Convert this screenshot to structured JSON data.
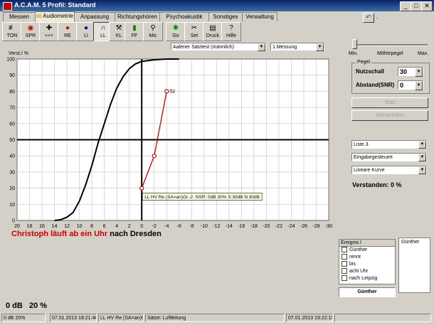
{
  "window": {
    "title": "A.C.A.M. 5  Profil: Standard"
  },
  "tabs": [
    "Messen",
    "Audiometrie",
    "Anpassung",
    "Richtungshören",
    "Psychoakustik",
    "Sonstiges",
    "Verwaltung"
  ],
  "toolbar": [
    "TON",
    "SPR",
    "+++",
    "RE",
    "LI",
    "LL",
    "KL",
    "FF",
    "Mic",
    "Go",
    "Set",
    "Druck",
    "Hilfe"
  ],
  "test_select": "Aalener Satztest (männlich)",
  "measure_select": "1.Messung",
  "level_slider": {
    "min": "Min.",
    "mid": "Mithörpegel",
    "max": "Max."
  },
  "pegel": {
    "title": "Pegel",
    "nutzschall_label": "Nutzschall",
    "nutzschall_value": "30",
    "abstand_label": "Abstand(SNR)",
    "abstand_value": "0"
  },
  "buttons": {
    "start": "Start",
    "repeat": "Wiederholen"
  },
  "dropdowns": [
    "Liste 3",
    "Eingabegesteuert",
    "Lineare Kurve"
  ],
  "verstanden": "Verstanden: 0 %",
  "sentence": {
    "part1": "Christoph läuft ab ein Uhr",
    "part2": "nach Dresden"
  },
  "result": "0 dB   20 %",
  "ereignis": {
    "header": "Ereignis l",
    "items": [
      "Günther",
      "rennt",
      "bis",
      "acht Uhr",
      "nach Leipzig"
    ],
    "right_title": "Günther",
    "selected": "Günther"
  },
  "statusbar": [
    "0 dB   20%",
    "07.01.2013 19:21:46",
    "LL HV Re (SA=an)Gr.:",
    "Sätze: Luftleitung",
    "07.01.2013 19:22:15"
  ],
  "chart_data": {
    "type": "line",
    "ylabel": "Verst./ %",
    "xlabel": "",
    "x_ticks": [
      20,
      18,
      16,
      14,
      12,
      10,
      8,
      6,
      4,
      2,
      0,
      -2,
      -4,
      -6,
      -8,
      -10,
      -12,
      -14,
      -16,
      -18,
      -20,
      -22,
      -24,
      -26,
      -28,
      -30
    ],
    "y_ticks": [
      0,
      10,
      20,
      30,
      40,
      50,
      60,
      70,
      80,
      90,
      100
    ],
    "xlim": [
      20,
      -30
    ],
    "ylim": [
      0,
      100
    ],
    "grid": true,
    "series": [
      {
        "color": "#000000",
        "x": [
          14,
          13,
          12,
          11,
          10,
          9,
          8,
          7,
          6,
          5,
          4,
          3,
          2,
          1,
          0,
          -2,
          -4,
          -6
        ],
        "y": [
          0,
          0.5,
          2,
          5,
          12,
          22,
          34,
          48,
          60,
          72,
          82,
          89,
          94,
          97,
          98.5,
          99.5,
          100,
          100
        ]
      },
      {
        "color": "#cc0000",
        "x": [
          0,
          -2,
          -4
        ],
        "y": [
          20,
          40,
          80
        ],
        "point_labels": [
          "",
          "",
          "Sz"
        ]
      }
    ],
    "annotation": "LL HV Re (SA=an)Gr.:2: NSR: 0dB 20% S:30dB N:30dB"
  }
}
